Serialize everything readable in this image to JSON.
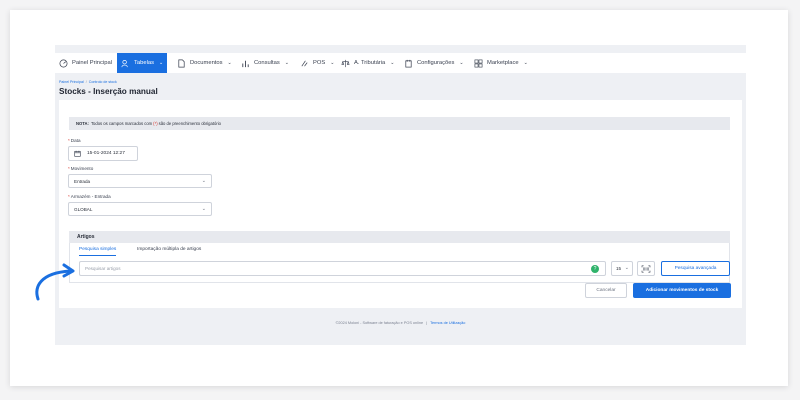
{
  "nav": {
    "items": [
      {
        "label": "Painel Principal",
        "icon": "dashboard-icon",
        "caret": ""
      },
      {
        "label": "Tabelas",
        "icon": "users-icon",
        "caret": "⌄"
      },
      {
        "label": "Documentos",
        "icon": "document-icon",
        "caret": "⌄"
      },
      {
        "label": "Consultas",
        "icon": "chart-icon",
        "caret": "⌄"
      },
      {
        "label": "POS",
        "icon": "pos-icon",
        "caret": "⌄"
      },
      {
        "label": "A. Tributária",
        "icon": "balance-icon",
        "caret": "⌄"
      },
      {
        "label": "Configurações",
        "icon": "settings-icon",
        "caret": "⌄"
      },
      {
        "label": "Marketplace",
        "icon": "marketplace-icon",
        "caret": "⌄"
      }
    ],
    "active_index": 1
  },
  "breadcrumb": {
    "home": "Painel Principal",
    "sep": "/",
    "current": "Controlo de stock"
  },
  "page_title": "Stocks - Inserção manual",
  "note": {
    "label": "NOTA:",
    "text_before": "Todos os campos marcados com",
    "marker": "(*)",
    "text_after": "são de preenchimento obrigatório"
  },
  "form": {
    "required_mark": "*",
    "date": {
      "label": "Data",
      "value": "15-01-2024 12:27"
    },
    "movimento": {
      "label": "Movimento",
      "value": "Entrada"
    },
    "armazem": {
      "label": "Armazém - Entrada",
      "value": "GLOBAL"
    }
  },
  "artigos": {
    "header": "Artigos",
    "tabs": [
      "Pesquisa simples",
      "Importação múltipla de artigos"
    ],
    "search_placeholder": "Pesquisar artigos",
    "help_symbol": "?",
    "qty": "15",
    "advanced_button": "Pesquisa avançada"
  },
  "actions": {
    "cancel": "Cancelar",
    "add": "Adicionar movimentos de stock"
  },
  "footer": {
    "text": "©2024 Moloni - Software de faturação e POS online",
    "sep": "|",
    "link": "Termos de Utilização"
  },
  "colors": {
    "accent": "#1a6fe0",
    "required": "#d9342b",
    "success": "#2fb36b",
    "annotation": "#1a6fe0"
  },
  "chevron": "⌄"
}
